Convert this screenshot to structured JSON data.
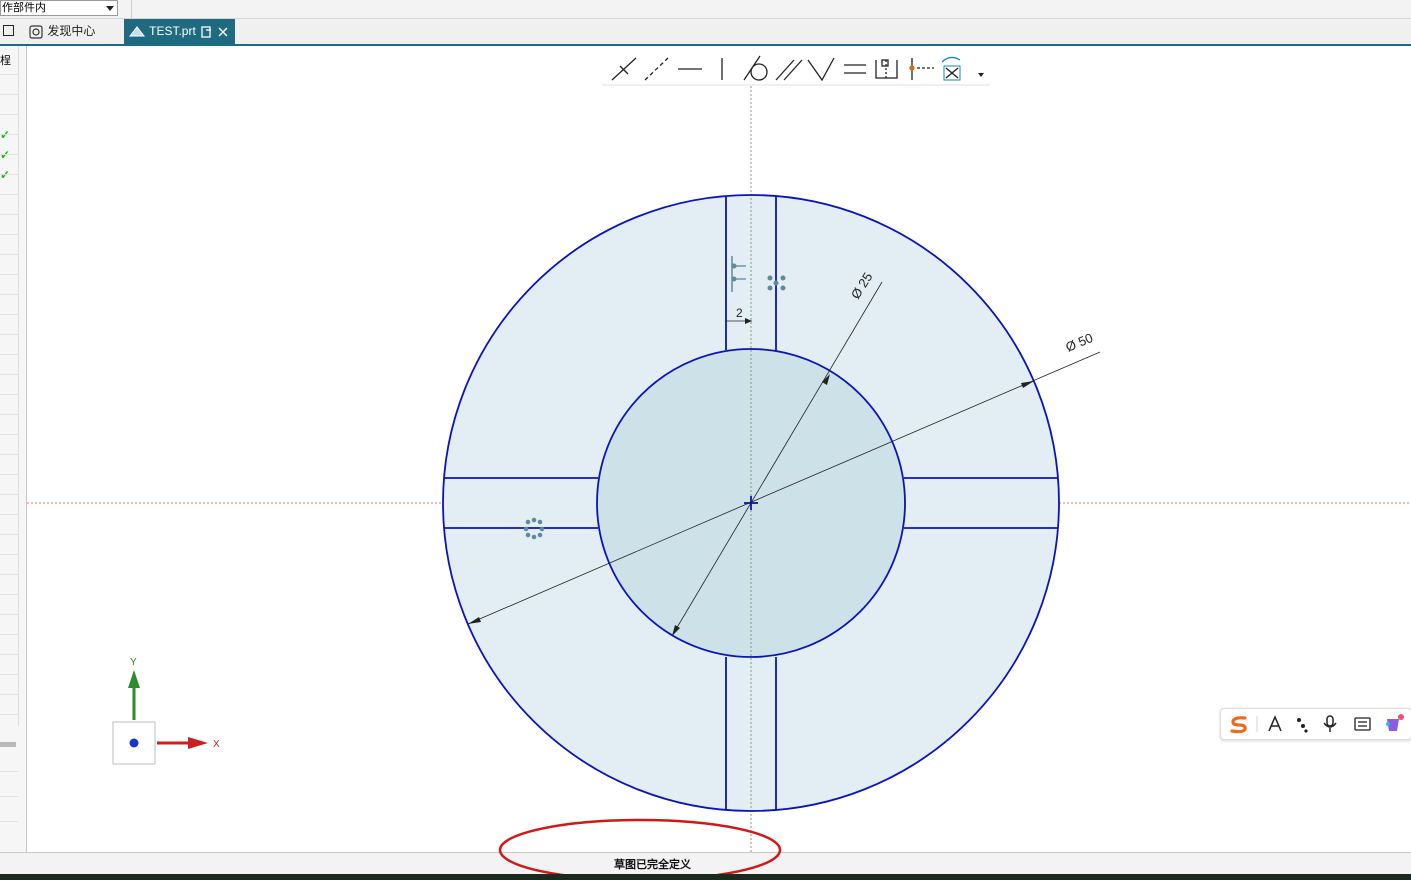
{
  "toolbar_top": {
    "scope_dropdown": "作部件内"
  },
  "tabs": [
    {
      "label": "发现中心",
      "active": false
    },
    {
      "label": "TEST.prt",
      "active": true
    }
  ],
  "sidebar": {
    "partial_label": "桯",
    "checks": [
      "✓",
      "✓",
      "✓"
    ]
  },
  "sketch": {
    "dimensions": {
      "outer_diameter": "Ø 50",
      "inner_diameter": "Ø 25",
      "slot_width": "2"
    },
    "triad": {
      "x_label": "X",
      "y_label": "Y"
    }
  },
  "status_bar": {
    "message": "草图已完全定义"
  },
  "colors": {
    "sketch_line": "#0a14b8",
    "fill": "#e2eef3",
    "tab_active": "#1e6a80",
    "annotation": "#d01818"
  }
}
